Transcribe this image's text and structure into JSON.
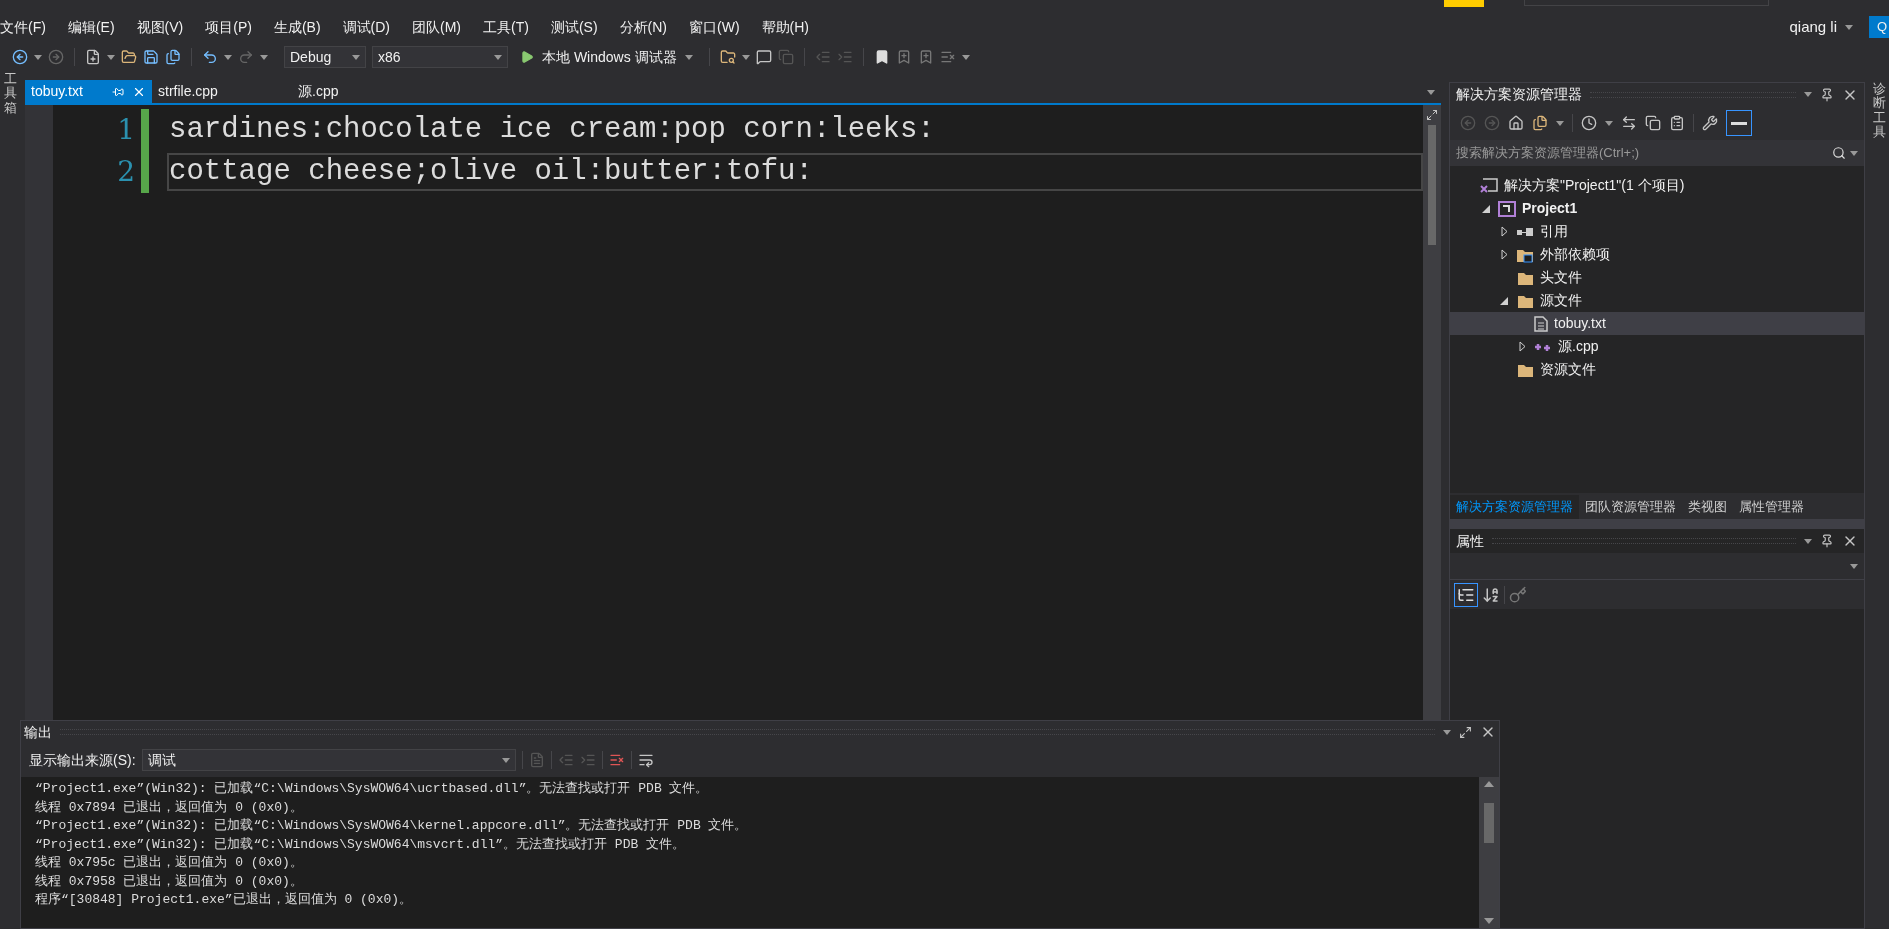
{
  "menu": [
    "文件(F)",
    "编辑(E)",
    "视图(V)",
    "项目(P)",
    "生成(B)",
    "调试(D)",
    "团队(M)",
    "工具(T)",
    "测试(S)",
    "分析(N)",
    "窗口(W)",
    "帮助(H)"
  ],
  "user": {
    "name": "qiang li",
    "initials": "Q"
  },
  "toolbar": {
    "configuration": "Debug",
    "platform": "x86",
    "run": "本地 Windows 调试器"
  },
  "side_left": "工具箱",
  "side_right": "诊断工具",
  "tabs": [
    {
      "label": "tobuy.txt",
      "selected": true
    },
    {
      "label": "strfile.cpp",
      "selected": false
    },
    {
      "label": "源.cpp",
      "selected": false
    }
  ],
  "editor": {
    "lines": [
      {
        "number": "1",
        "text": "sardines:chocolate ice cream:pop corn:leeks:",
        "current": false
      },
      {
        "number": "2",
        "text": "cottage cheese;olive oil:butter:tofu:",
        "current": true
      }
    ]
  },
  "solution_explorer": {
    "title": "解决方案资源管理器",
    "search_placeholder": "搜索解决方案资源管理器(Ctrl+;)",
    "tree": [
      {
        "kind": "solution",
        "label": "解决方案\"Project1\"(1 个项目)",
        "selected": false,
        "children": [
          {
            "kind": "project",
            "label": "Project1",
            "expanded": true,
            "selected": false,
            "children": [
              {
                "kind": "references",
                "label": "引用",
                "expanded": false,
                "selected": false
              },
              {
                "kind": "external",
                "label": "外部依赖项",
                "expanded": false,
                "selected": false
              },
              {
                "kind": "folder",
                "label": "头文件",
                "selected": false
              },
              {
                "kind": "folder",
                "label": "源文件",
                "expanded": true,
                "selected": false,
                "children": [
                  {
                    "kind": "file",
                    "label": "tobuy.txt",
                    "selected": true
                  },
                  {
                    "kind": "cpp",
                    "label": "源.cpp",
                    "expanded": false,
                    "selected": false
                  }
                ]
              },
              {
                "kind": "folder",
                "label": "资源文件",
                "selected": false
              }
            ]
          }
        ]
      }
    ]
  },
  "panel_tabs": [
    {
      "label": "解决方案资源管理器",
      "selected": true
    },
    {
      "label": "团队资源管理器",
      "selected": false
    },
    {
      "label": "类视图",
      "selected": false
    },
    {
      "label": "属性管理器",
      "selected": false
    }
  ],
  "properties": {
    "title": "属性"
  },
  "output": {
    "title": "输出",
    "source_label": "显示输出来源(S):",
    "source_value": "调试",
    "lines": [
      "“Project1.exe”(Win32): 已加载“C:\\Windows\\SysWOW64\\ucrtbased.dll”。无法查找或打开 PDB 文件。",
      "线程 0x7894 已退出，返回值为 0 (0x0)。",
      "“Project1.exe”(Win32): 已加载“C:\\Windows\\SysWOW64\\kernel.appcore.dll”。无法查找或打开 PDB 文件。",
      "“Project1.exe”(Win32): 已加载“C:\\Windows\\SysWOW64\\msvcrt.dll”。无法查找或打开 PDB 文件。",
      "线程 0x795c 已退出，返回值为 0 (0x0)。",
      "线程 0x7958 已退出，返回值为 0 (0x0)。",
      "程序“[30848] Project1.exe”已退出，返回值为 0 (0x0)。"
    ]
  }
}
